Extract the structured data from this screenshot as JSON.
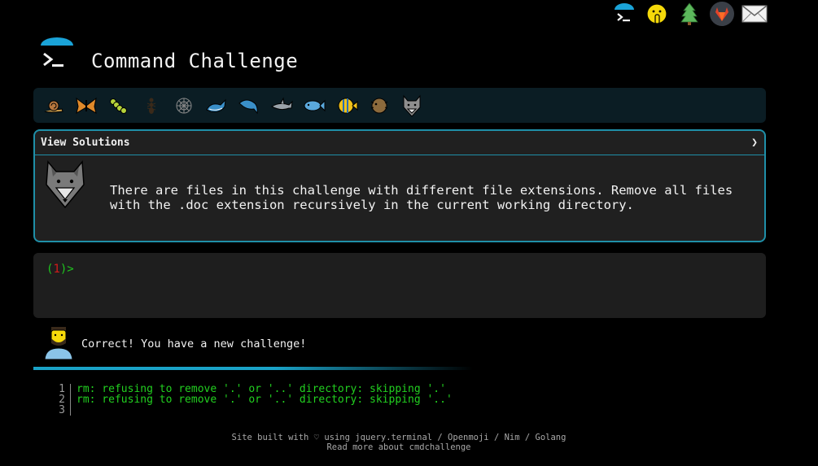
{
  "header": {
    "title": "Command Challenge"
  },
  "topnav": [
    {
      "name": "cmdchallenge-icon"
    },
    {
      "name": "shushing-face-icon"
    },
    {
      "name": "tree-icon"
    },
    {
      "name": "gitlab-icon"
    },
    {
      "name": "envelope-icon"
    }
  ],
  "levels": [
    "snail-icon",
    "butterfly-icon",
    "caterpillar-icon",
    "ant-icon",
    "spider-web-icon",
    "whale-icon",
    "dolphin-icon",
    "shark-icon",
    "fish-icon",
    "tropical-fish-icon",
    "blowfish-icon",
    "wolf-icon"
  ],
  "solutions": {
    "header": "View Solutions",
    "chevron": "❯",
    "challenge": "There are files in this challenge with different file extensions. Remove all files with the .doc extension recursively in the current working directory."
  },
  "terminal": {
    "open": "(",
    "number": "1",
    "close": ")>"
  },
  "result": {
    "text": "Correct! You have a new challenge!"
  },
  "output": {
    "line_numbers": [
      "1",
      "2",
      "3"
    ],
    "lines": [
      "rm: refusing to remove '.' or '..' directory: skipping '.'",
      "rm: refusing to remove '.' or '..' directory: skipping '..'",
      ""
    ]
  },
  "footer": {
    "line1": "Site built with ♡ using jquery.terminal / Openmoji / Nim / Golang",
    "line2": "Read more about cmdchallenge"
  },
  "colors": {
    "background": "#000000",
    "accent": "#1f8fa8",
    "prompt_green": "#1ec41e",
    "prompt_red": "#d11b1b",
    "output_green": "#22d020"
  }
}
